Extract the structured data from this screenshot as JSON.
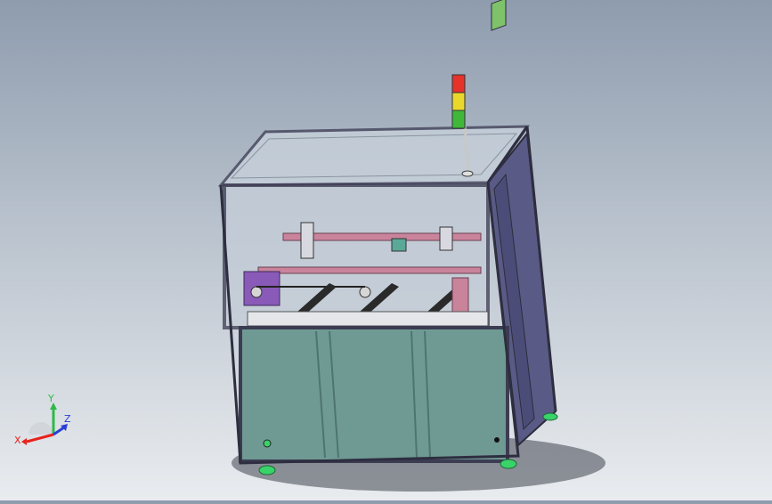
{
  "viewport": {
    "background_top": "#8e9cae",
    "background_bottom": "#e9ecef",
    "model_description_icon": "machine-enclosure-model"
  },
  "triad": {
    "x_label": "X",
    "y_label": "Y",
    "z_label": "Z",
    "x_color": "#e8221c",
    "y_color": "#2fb84a",
    "z_color": "#2a3fd6"
  },
  "signal_tower": {
    "colors": [
      "#e5322b",
      "#e9d82b",
      "#3fb83a"
    ]
  },
  "colors": {
    "frame": "#3c3c52",
    "lower_panel": "#6f9a94",
    "side_panel": "#5a5a86",
    "glass": "#c9d2dc",
    "purple_part": "#8a5ab8",
    "pink_part": "#c9849c",
    "foot": "#39d36a"
  }
}
